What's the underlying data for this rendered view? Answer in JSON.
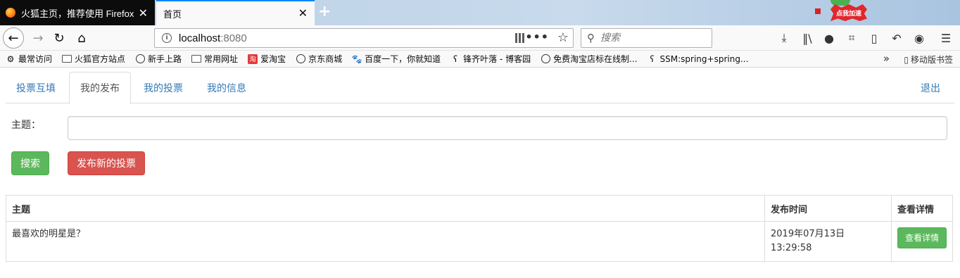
{
  "browser": {
    "tabs": [
      {
        "title": "火狐主页，推荐使用 Firefox 火狐",
        "active": false
      },
      {
        "title": "首页",
        "active": true
      }
    ],
    "speed_badge": "点我加速",
    "url": {
      "host": "localhost",
      "port": ":8080"
    },
    "search_placeholder": "搜索",
    "bookmarks": [
      {
        "label": "最常访问",
        "icon": "gear-icon"
      },
      {
        "label": "火狐官方站点",
        "icon": "folder-icon"
      },
      {
        "label": "新手上路",
        "icon": "globe-icon"
      },
      {
        "label": "常用网址",
        "icon": "folder-icon"
      },
      {
        "label": "爱淘宝",
        "icon": "taobao-icon"
      },
      {
        "label": "京东商城",
        "icon": "globe-icon"
      },
      {
        "label": "百度一下，你就知道",
        "icon": "baidu-icon"
      },
      {
        "label": "锋齐叶落 - 博客园",
        "icon": "bookmark-icon"
      },
      {
        "label": "免费淘宝店标在线制...",
        "icon": "globe-icon"
      },
      {
        "label": "SSM:spring+spring...",
        "icon": "bookmark-icon"
      }
    ],
    "mobile_bookmarks": "移动版书签"
  },
  "app": {
    "nav": {
      "tabs": [
        {
          "label": "投票互填",
          "active": false
        },
        {
          "label": "我的发布",
          "active": true
        },
        {
          "label": "我的投票",
          "active": false
        },
        {
          "label": "我的信息",
          "active": false
        }
      ],
      "logout": "退出"
    },
    "form": {
      "subject_label": "主题：",
      "subject_value": "",
      "search_button": "搜索",
      "publish_button": "发布新的投票"
    },
    "table": {
      "headers": {
        "subject": "主题",
        "time": "发布时间",
        "detail": "查看详情"
      },
      "rows": [
        {
          "subject": "最喜欢的明星是？",
          "time": "2019年07月13日 13:29:58",
          "detail_button": "查看详情"
        }
      ]
    }
  }
}
